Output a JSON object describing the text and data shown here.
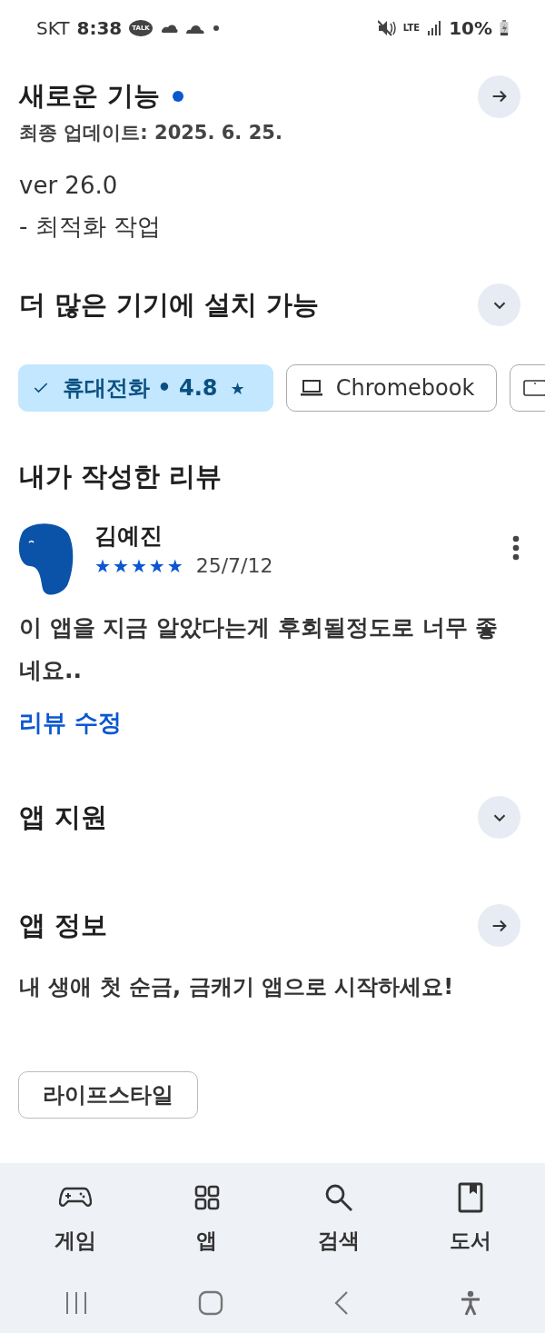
{
  "status_bar": {
    "carrier": "SKT",
    "time": "8:38",
    "talk_badge": "TALK",
    "network": "LTE",
    "battery": "10%"
  },
  "whats_new": {
    "title": "새로운 기능",
    "new_dot": true,
    "updated": "최종 업데이트: 2025. 6. 25.",
    "lines": [
      "ver 26.0",
      "- 최적화 작업"
    ]
  },
  "devices": {
    "title": "더 많은 기기에 설치 가능",
    "expanded": false,
    "chips": [
      {
        "kind": "phone",
        "label": "휴대전화 • 4.8",
        "rating_icon": "★",
        "selected": true
      },
      {
        "kind": "laptop",
        "label": "Chromebook",
        "selected": false
      },
      {
        "kind": "tablet",
        "selected": false
      }
    ]
  },
  "my_review": {
    "title": "내가 작성한 리뷰",
    "author": "김예진",
    "stars": 5,
    "date": "25/7/12",
    "text": "이 앱을 지금 알았다는게 후회될정도로 너무 좋네요..",
    "edit_link": "리뷰 수정"
  },
  "app_support": {
    "title": "앱 지원",
    "expanded": false
  },
  "about": {
    "title": "앱 정보",
    "description": "내 생애 첫 순금, 금캐기 앱으로 시작하세요!",
    "tags": [
      "라이프스타일"
    ]
  },
  "bottom_nav": [
    {
      "kind": "games",
      "label": "게임"
    },
    {
      "kind": "apps",
      "label": "앱"
    },
    {
      "kind": "search",
      "label": "검색"
    },
    {
      "kind": "books",
      "label": "도서"
    }
  ]
}
